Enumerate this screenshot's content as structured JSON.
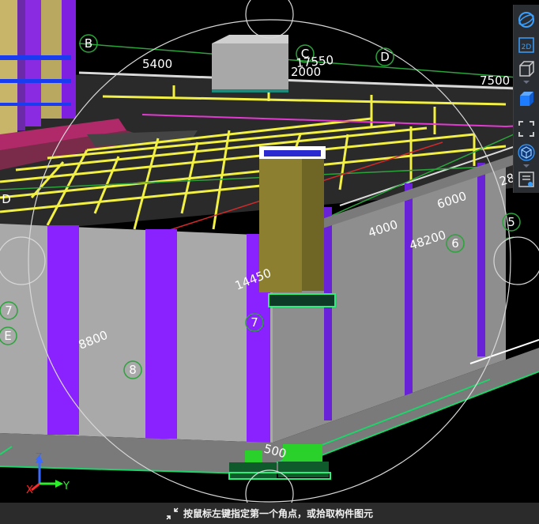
{
  "viewport": {
    "axis_markers": [
      "B",
      "C",
      "D",
      "E",
      "5",
      "6",
      "7",
      "8",
      "7"
    ],
    "cut_marker": "D",
    "dimensions": [
      "5400",
      "17550",
      "2000",
      "7500",
      "6000",
      "4000",
      "48200",
      "14450",
      "8800",
      "28",
      "500"
    ],
    "triad": {
      "x_label": "X",
      "y_label": "Y",
      "z_label": "Z"
    }
  },
  "toolbar": {
    "items": [
      {
        "icon": "orbit-icon",
        "active": true
      },
      {
        "icon": "view-2d-icon",
        "label": "2D"
      },
      {
        "icon": "view-3d-box-icon"
      },
      {
        "icon": "view-3d-blue-box-icon",
        "active": true
      },
      {
        "icon": "fit-frame-icon"
      },
      {
        "icon": "iso-cube-icon",
        "active": true
      },
      {
        "icon": "properties-panel-icon"
      }
    ]
  },
  "status": {
    "message": "按鼠标左键指定第一个角点，或拾取构件图元"
  }
}
